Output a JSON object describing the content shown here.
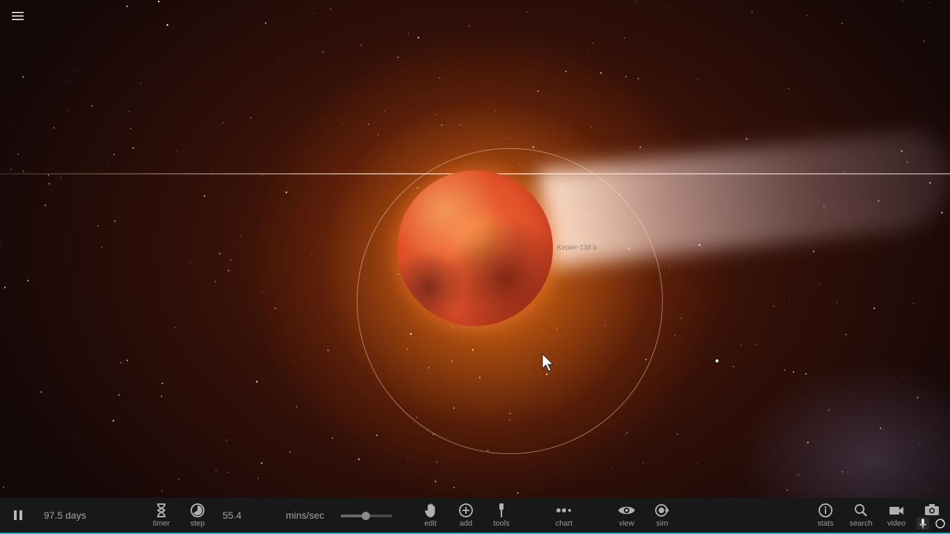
{
  "viewport": {
    "planet_label": "Kepler-138 b"
  },
  "playback": {
    "elapsed": "97.5 days",
    "speed_value": "55.4",
    "speed_unit": "mins/sec",
    "speed_level": 0.48
  },
  "toolbar": {
    "timer_label": "timer",
    "step_label": "step",
    "edit_label": "edit",
    "add_label": "add",
    "tools_label": "tools",
    "chart_label": "chart",
    "view_label": "view",
    "sim_label": "sim",
    "stats_label": "stats",
    "search_label": "search",
    "video_label": "video"
  },
  "icons": {
    "menu": "hamburger-menu-icon",
    "pause": "pause-icon",
    "timer": "hourglass-icon",
    "step": "half-circle-icon",
    "edit": "hand-icon",
    "add": "plus-circle-icon",
    "tools": "tool-icon",
    "chart": "dots-icon",
    "view": "eye-icon",
    "sim": "orbit-icon",
    "stats": "info-icon",
    "search": "magnifier-icon",
    "video": "video-camera-icon",
    "camera": "camera-icon",
    "mic": "microphone-icon",
    "help": "refresh-icon"
  },
  "colors": {
    "accent": "#3aa7c7",
    "toolbar_bg": "#181819",
    "planet": "#e0502a"
  }
}
